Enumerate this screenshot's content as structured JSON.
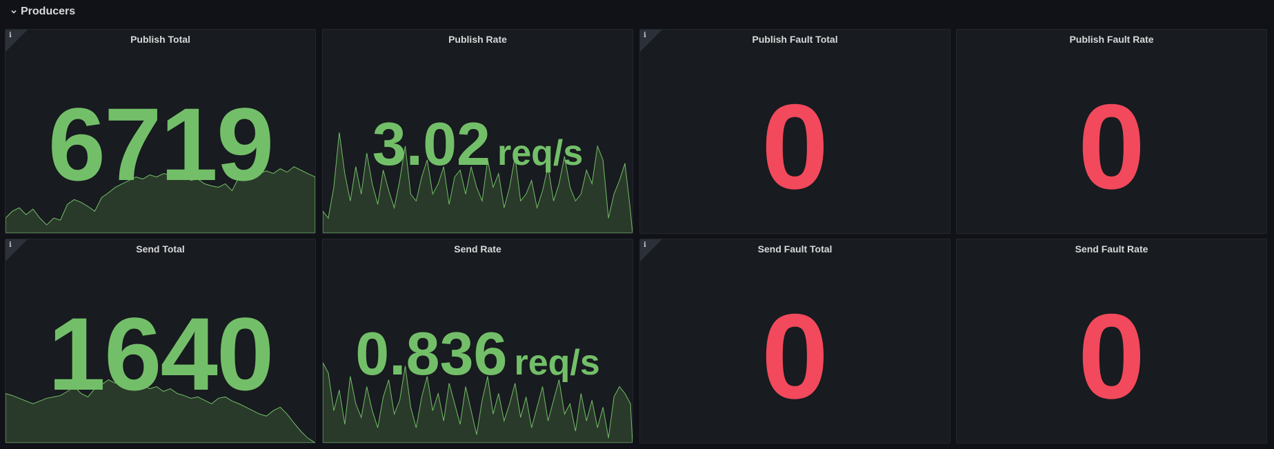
{
  "row": {
    "title": "Producers",
    "icon": "chevron-down-icon"
  },
  "colors": {
    "green": "#73bf69",
    "red": "#f2495c",
    "spark_fill": "#2a3a2a",
    "background": "#111217",
    "panel": "#181b1f"
  },
  "panels": [
    {
      "title": "Publish Total",
      "value": "6719",
      "unit": "",
      "color": "green",
      "info": true,
      "spark": true
    },
    {
      "title": "Publish Rate",
      "value": "3.02",
      "unit": "req/s",
      "color": "green",
      "info": false,
      "spark": true
    },
    {
      "title": "Publish Fault Total",
      "value": "0",
      "unit": "",
      "color": "red",
      "info": true,
      "spark": false
    },
    {
      "title": "Publish Fault Rate",
      "value": "0",
      "unit": "",
      "color": "red",
      "info": false,
      "spark": false
    },
    {
      "title": "Send Total",
      "value": "1640",
      "unit": "",
      "color": "green",
      "info": true,
      "spark": true
    },
    {
      "title": "Send Rate",
      "value": "0.836",
      "unit": "req/s",
      "color": "green",
      "info": false,
      "spark": true
    },
    {
      "title": "Send Fault Total",
      "value": "0",
      "unit": "",
      "color": "red",
      "info": true,
      "spark": false
    },
    {
      "title": "Send Fault Rate",
      "value": "0",
      "unit": "",
      "color": "red",
      "info": false,
      "spark": false
    }
  ]
}
